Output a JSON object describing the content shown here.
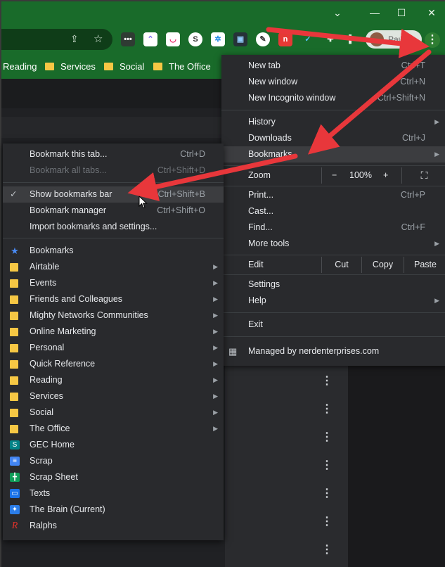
{
  "window": {
    "chevron": "⌄",
    "minimize": "—",
    "maximize": "☐",
    "close": "✕"
  },
  "toolbar": {
    "profile_label": "Pause",
    "icons": [
      "share-icon",
      "star-icon",
      "extension-dots-icon",
      "clickup-icon",
      "extension-ghost-icon",
      "s-icon",
      "puzzle-blue-icon",
      "box-icon",
      "feather-icon",
      "n-icon",
      "check-icon",
      "puzzle-icon",
      "sidepanel-icon"
    ]
  },
  "bookmarks_bar": {
    "items": [
      "Reading",
      "Services",
      "Social",
      "The Office"
    ]
  },
  "main_menu": {
    "new_tab": {
      "label": "New tab",
      "shortcut": "Ctrl+T"
    },
    "new_window": {
      "label": "New window",
      "shortcut": "Ctrl+N"
    },
    "incognito": {
      "label": "New Incognito window",
      "shortcut": "Ctrl+Shift+N"
    },
    "history": {
      "label": "History"
    },
    "downloads": {
      "label": "Downloads",
      "shortcut": "Ctrl+J"
    },
    "bookmarks": {
      "label": "Bookmarks"
    },
    "zoom": {
      "label": "Zoom",
      "minus": "−",
      "value": "100%",
      "plus": "+"
    },
    "print": {
      "label": "Print...",
      "shortcut": "Ctrl+P"
    },
    "cast": {
      "label": "Cast..."
    },
    "find": {
      "label": "Find...",
      "shortcut": "Ctrl+F"
    },
    "more_tools": {
      "label": "More tools"
    },
    "edit": {
      "label": "Edit",
      "cut": "Cut",
      "copy": "Copy",
      "paste": "Paste"
    },
    "settings": {
      "label": "Settings"
    },
    "help": {
      "label": "Help"
    },
    "exit": {
      "label": "Exit"
    },
    "managed": {
      "label": "Managed by nerdenterprises.com"
    }
  },
  "bookmarks_menu": {
    "bookmark_tab": {
      "label": "Bookmark this tab...",
      "shortcut": "Ctrl+D"
    },
    "bookmark_all": {
      "label": "Bookmark all tabs...",
      "shortcut": "Ctrl+Shift+D"
    },
    "show_bar": {
      "label": "Show bookmarks bar",
      "shortcut": "Ctrl+Shift+B",
      "checked": true
    },
    "manager": {
      "label": "Bookmark manager",
      "shortcut": "Ctrl+Shift+O"
    },
    "import": {
      "label": "Import bookmarks and settings..."
    },
    "items": [
      {
        "label": "Bookmarks",
        "icon": "star-icon",
        "color": "#4a8cf7",
        "submenu": false
      },
      {
        "label": "Airtable",
        "icon": "folder-icon",
        "submenu": true
      },
      {
        "label": "Events",
        "icon": "folder-icon",
        "submenu": true
      },
      {
        "label": "Friends and Colleagues",
        "icon": "folder-icon",
        "submenu": true
      },
      {
        "label": "Mighty Networks Communities",
        "icon": "folder-icon",
        "submenu": true
      },
      {
        "label": "Online Marketing",
        "icon": "folder-icon",
        "submenu": true
      },
      {
        "label": "Personal",
        "icon": "folder-icon",
        "submenu": true
      },
      {
        "label": "Quick Reference",
        "icon": "folder-icon",
        "submenu": true
      },
      {
        "label": "Reading",
        "icon": "folder-icon",
        "submenu": true
      },
      {
        "label": "Services",
        "icon": "folder-icon",
        "submenu": true
      },
      {
        "label": "Social",
        "icon": "folder-icon",
        "submenu": true
      },
      {
        "label": "The Office",
        "icon": "folder-icon",
        "submenu": true
      },
      {
        "label": "GEC Home",
        "icon": "sharepoint-icon",
        "color": "#038387",
        "submenu": false
      },
      {
        "label": "Scrap",
        "icon": "docs-icon",
        "color": "#4285f4",
        "submenu": false
      },
      {
        "label": "Scrap Sheet",
        "icon": "sheets-icon",
        "color": "#0f9d58",
        "submenu": false
      },
      {
        "label": "Texts",
        "icon": "messages-icon",
        "color": "#1a73e8",
        "submenu": false
      },
      {
        "label": "The Brain (Current)",
        "icon": "brain-icon",
        "color": "#2b7de9",
        "submenu": false
      },
      {
        "label": "Ralphs",
        "icon": "ralphs-icon",
        "color": "#e0322b",
        "submenu": false
      }
    ]
  },
  "colors": {
    "title_green": "#196b2a",
    "menu_bg": "#292a2d",
    "arrow_red": "#e8373b",
    "folder_yellow": "#f6c744"
  }
}
